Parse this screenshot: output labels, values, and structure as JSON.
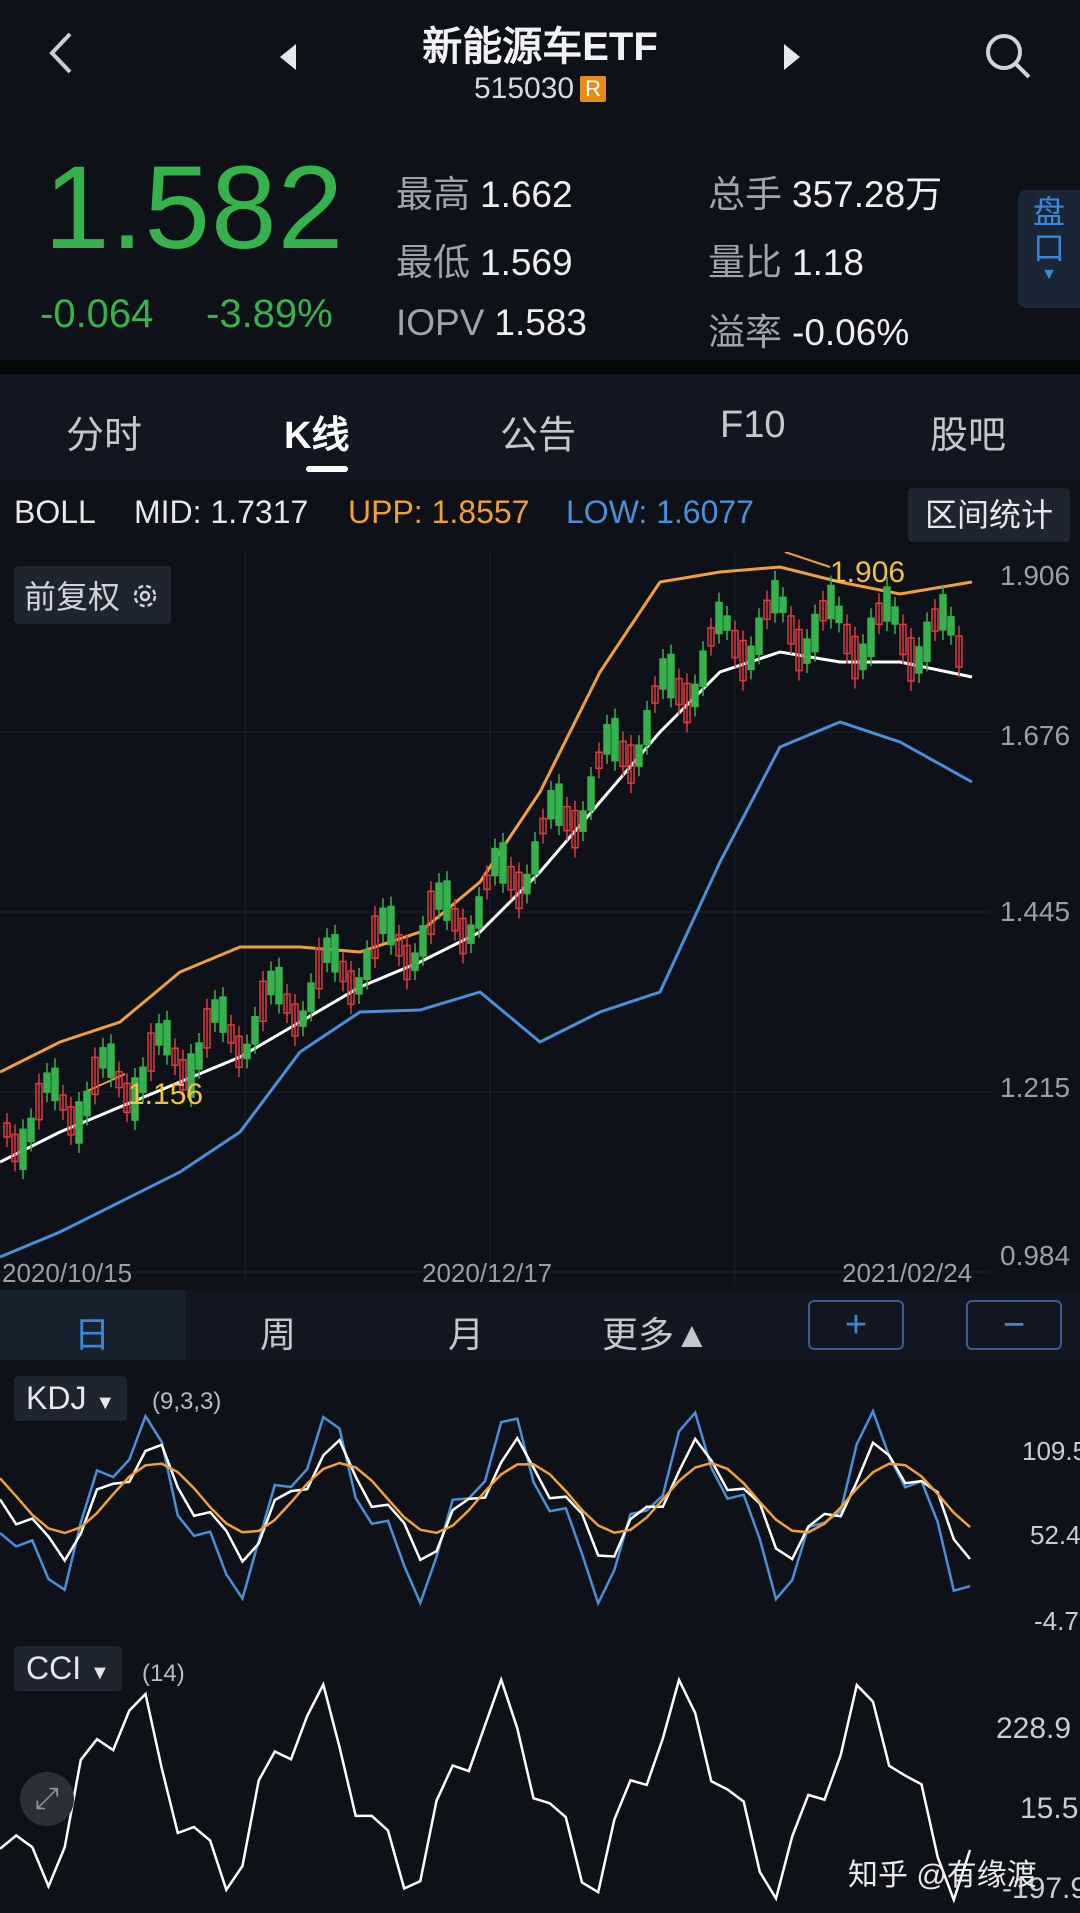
{
  "header": {
    "back_icon": "chevron-left-icon",
    "title": "新能源车ETF",
    "code": "515030",
    "badge": "R",
    "search_icon": "search-icon"
  },
  "quote": {
    "price": "1.582",
    "change": "-0.064",
    "change_pct": "-3.89%",
    "stats": [
      {
        "label": "最高",
        "value": "1.662"
      },
      {
        "label": "最低",
        "value": "1.569"
      },
      {
        "label": "IOPV",
        "value": "1.583"
      },
      {
        "label": "总手",
        "value": "357.28万"
      },
      {
        "label": "量比",
        "value": "1.18"
      },
      {
        "label": "溢率",
        "value": "-0.06%"
      }
    ],
    "side_tab": "盘口"
  },
  "tabs": [
    "分时",
    "K线",
    "公告",
    "F10",
    "股吧"
  ],
  "boll": {
    "name": "BOLL",
    "mid": "MID: 1.7317",
    "upp": "UPP: 1.8557",
    "low": "LOW: 1.6077",
    "range_button": "区间统计"
  },
  "kline": {
    "adjust_label": "前复权",
    "y_ticks": [
      "1.906",
      "1.676",
      "1.445",
      "1.215",
      "0.984"
    ],
    "dates": [
      "2020/10/15",
      "2020/12/17",
      "2021/02/24"
    ],
    "high_marker": "1.906",
    "low_marker": "1.156"
  },
  "period_bar": {
    "items": [
      "日",
      "周",
      "月",
      "更多▲"
    ],
    "zoom_in": "+",
    "zoom_out": "−"
  },
  "kdj": {
    "name": "KDJ",
    "params": "(9,3,3)",
    "y_ticks": [
      "109.5",
      "52.4",
      "-4.7"
    ]
  },
  "cci": {
    "name": "CCI",
    "params": "(14)",
    "y_ticks": [
      "228.9",
      "15.5",
      "-197.9"
    ]
  },
  "watermark": "知乎 @有缘渡",
  "colors": {
    "up": "#e0393e",
    "down": "#35b24c",
    "upp": "#f0a03a",
    "mid": "#ffffff",
    "low": "#4a8fd8"
  }
}
